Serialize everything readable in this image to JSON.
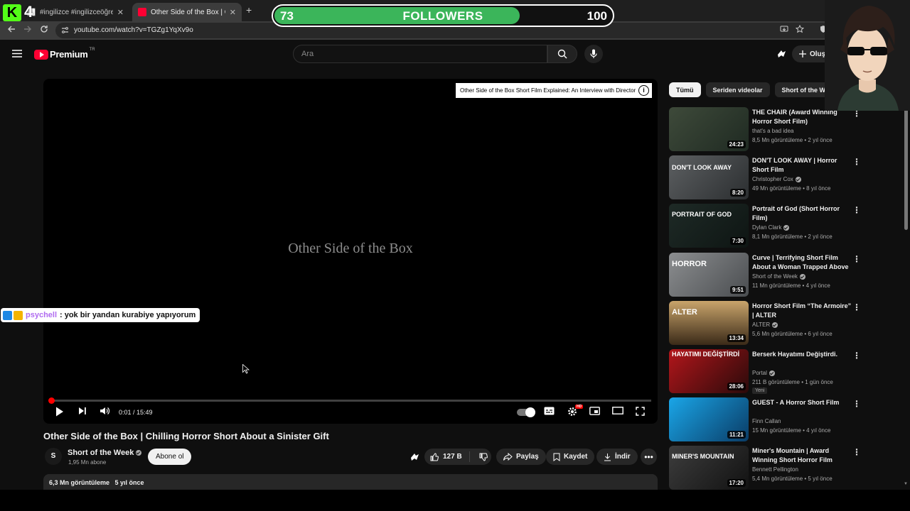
{
  "browser": {
    "tabs": [
      {
        "label": "#ingilizce #ingilizceöğreniyorum"
      },
      {
        "label": "Other Side of the Box | Chilling"
      }
    ],
    "url": "youtube.com/watch?v=TGZg1YqXv9o",
    "new_tab_symbol": "+",
    "close_symbol": "✕"
  },
  "stream_overlay": {
    "kick_letter": "K",
    "kick_count": "4",
    "followers": {
      "current": "73",
      "label": "FOLLOWERS",
      "goal": "100",
      "progress": 0.73
    },
    "chat": {
      "user": "psychell",
      "separator": ":",
      "message": "yok bir yandan kurabiye yapıyorum"
    }
  },
  "youtube": {
    "logo_word": "Premium",
    "logo_region": "TR",
    "search_placeholder": "Ara",
    "create_label": "Oluştur"
  },
  "player": {
    "film_title": "Other Side of the Box",
    "info_card": "Other Side of the Box Short Film Explained: An Interview with Director",
    "current_time": "0:01",
    "duration": "15:49",
    "time_display": "0:01 / 15:49",
    "progress": 0.002,
    "hd_badge": "HD"
  },
  "video": {
    "title": "Other Side of the Box | Chilling Horror Short About a Sinister Gift",
    "channel": "Short of the Week",
    "channel_avatar_text": "S",
    "subscribers": "1,95 Mn abone",
    "subscribe_label": "Abone ol",
    "likes": "127 B",
    "share_label": "Paylaş",
    "save_label": "Kaydet",
    "download_label": "İndir",
    "views": "6,3 Mn görüntüleme",
    "age": "5 yıl önce"
  },
  "chips": [
    {
      "label": "Tümü",
      "active": true
    },
    {
      "label": "Seriden videolar",
      "active": false
    },
    {
      "label": "Short of the Week adlı",
      "active": false
    }
  ],
  "recommendations": [
    {
      "title": "THE CHAIR (Award Winning Horror Short Film)",
      "channel": "that's a bad idea",
      "verified": false,
      "meta": "8,5 Mn görüntüleme • 2 yıl önce",
      "duration": "24:23",
      "thumb_text": "",
      "badge": ""
    },
    {
      "title": "DON'T LOOK AWAY | Horror Short Film",
      "channel": "Christopher Cox",
      "verified": true,
      "meta": "49 Mn görüntüleme • 8 yıl önce",
      "duration": "8:20",
      "thumb_text": "DON'T LOOK AWAY",
      "badge": ""
    },
    {
      "title": "Portrait of God (Short Horror Film)",
      "channel": "Dylan Clark",
      "verified": true,
      "meta": "8,1 Mn görüntüleme • 2 yıl önce",
      "duration": "7:30",
      "thumb_text": "PORTRAIT OF GOD",
      "badge": ""
    },
    {
      "title": "Curve | Terrifying Short Film About a Woman Trapped Above a Void",
      "channel": "Short of the Week",
      "verified": true,
      "meta": "11 Mn görüntüleme • 4 yıl önce",
      "duration": "9:51",
      "thumb_text": "HORROR",
      "badge": ""
    },
    {
      "title": "Horror Short Film “The Armoire” | ALTER",
      "channel": "ALTER",
      "verified": true,
      "meta": "5,6 Mn görüntüleme • 6 yıl önce",
      "duration": "13:34",
      "thumb_text": "ALTER",
      "badge": ""
    },
    {
      "title": "Berserk Hayatımı Değiştirdi.",
      "channel": "Portal",
      "verified": true,
      "meta": "211 B görüntüleme • 1 gün önce",
      "duration": "28:06",
      "thumb_text": "HAYATIMI DEĞİŞTİRDİ",
      "badge": "Yeni"
    },
    {
      "title": "GUEST - A Horror Short Film",
      "channel": "Finn Callan",
      "verified": false,
      "meta": "15 Mn görüntüleme • 4 yıl önce",
      "duration": "11:21",
      "thumb_text": "",
      "badge": ""
    },
    {
      "title": "Miner's Mountain | Award Winning Short Horror Film",
      "channel": "Bennett Pellington",
      "verified": false,
      "meta": "5,4 Mn görüntüleme • 5 yıl önce",
      "duration": "17:20",
      "thumb_text": "MINER'S MOUNTAIN",
      "badge": ""
    }
  ],
  "theme": {
    "background": "#0f0f0f",
    "accent_red": "#ff0033",
    "followers_green": "#3bb55a",
    "kick_green": "#53fc18"
  }
}
